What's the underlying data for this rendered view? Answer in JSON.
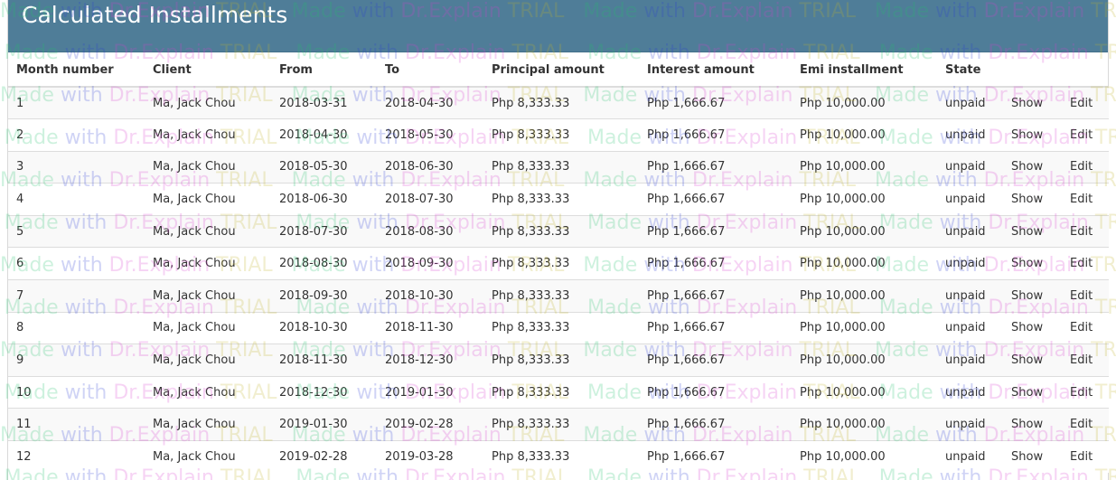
{
  "header": {
    "title": "Calculated Installments",
    "background_color": "#4f7d98"
  },
  "table": {
    "columns": [
      "Month number",
      "Client",
      "From",
      "To",
      "Principal amount",
      "Interest amount",
      "Emi installment",
      "State",
      "",
      ""
    ],
    "rows": [
      {
        "month": "1",
        "client": "Ma, Jack Chou",
        "from": "2018-03-31",
        "to": "2018-04-30",
        "principal": "Php 8,333.33",
        "interest": "Php 1,666.67",
        "emi": "Php 10,000.00",
        "state": "unpaid",
        "show": "Show",
        "edit": "Edit"
      },
      {
        "month": "2",
        "client": "Ma, Jack Chou",
        "from": "2018-04-30",
        "to": "2018-05-30",
        "principal": "Php 8,333.33",
        "interest": "Php 1,666.67",
        "emi": "Php 10,000.00",
        "state": "unpaid",
        "show": "Show",
        "edit": "Edit"
      },
      {
        "month": "3",
        "client": "Ma, Jack Chou",
        "from": "2018-05-30",
        "to": "2018-06-30",
        "principal": "Php 8,333.33",
        "interest": "Php 1,666.67",
        "emi": "Php 10,000.00",
        "state": "unpaid",
        "show": "Show",
        "edit": "Edit"
      },
      {
        "month": "4",
        "client": "Ma, Jack Chou",
        "from": "2018-06-30",
        "to": "2018-07-30",
        "principal": "Php 8,333.33",
        "interest": "Php 1,666.67",
        "emi": "Php 10,000.00",
        "state": "unpaid",
        "show": "Show",
        "edit": "Edit"
      },
      {
        "month": "5",
        "client": "Ma, Jack Chou",
        "from": "2018-07-30",
        "to": "2018-08-30",
        "principal": "Php 8,333.33",
        "interest": "Php 1,666.67",
        "emi": "Php 10,000.00",
        "state": "unpaid",
        "show": "Show",
        "edit": "Edit"
      },
      {
        "month": "6",
        "client": "Ma, Jack Chou",
        "from": "2018-08-30",
        "to": "2018-09-30",
        "principal": "Php 8,333.33",
        "interest": "Php 1,666.67",
        "emi": "Php 10,000.00",
        "state": "unpaid",
        "show": "Show",
        "edit": "Edit"
      },
      {
        "month": "7",
        "client": "Ma, Jack Chou",
        "from": "2018-09-30",
        "to": "2018-10-30",
        "principal": "Php 8,333.33",
        "interest": "Php 1,666.67",
        "emi": "Php 10,000.00",
        "state": "unpaid",
        "show": "Show",
        "edit": "Edit"
      },
      {
        "month": "8",
        "client": "Ma, Jack Chou",
        "from": "2018-10-30",
        "to": "2018-11-30",
        "principal": "Php 8,333.33",
        "interest": "Php 1,666.67",
        "emi": "Php 10,000.00",
        "state": "unpaid",
        "show": "Show",
        "edit": "Edit"
      },
      {
        "month": "9",
        "client": "Ma, Jack Chou",
        "from": "2018-11-30",
        "to": "2018-12-30",
        "principal": "Php 8,333.33",
        "interest": "Php 1,666.67",
        "emi": "Php 10,000.00",
        "state": "unpaid",
        "show": "Show",
        "edit": "Edit"
      },
      {
        "month": "10",
        "client": "Ma, Jack Chou",
        "from": "2018-12-30",
        "to": "2019-01-30",
        "principal": "Php 8,333.33",
        "interest": "Php 1,666.67",
        "emi": "Php 10,000.00",
        "state": "unpaid",
        "show": "Show",
        "edit": "Edit"
      },
      {
        "month": "11",
        "client": "Ma, Jack Chou",
        "from": "2019-01-30",
        "to": "2019-02-28",
        "principal": "Php 8,333.33",
        "interest": "Php 1,666.67",
        "emi": "Php 10,000.00",
        "state": "unpaid",
        "show": "Show",
        "edit": "Edit"
      },
      {
        "month": "12",
        "client": "Ma, Jack Chou",
        "from": "2019-02-28",
        "to": "2019-03-28",
        "principal": "Php 8,333.33",
        "interest": "Php 1,666.67",
        "emi": "Php 10,000.00",
        "state": "unpaid",
        "show": "Show",
        "edit": "Edit"
      }
    ]
  },
  "watermark": {
    "made": "Made",
    "with": "with",
    "brand": "Dr.Explain",
    "trial": "TRIAL"
  }
}
